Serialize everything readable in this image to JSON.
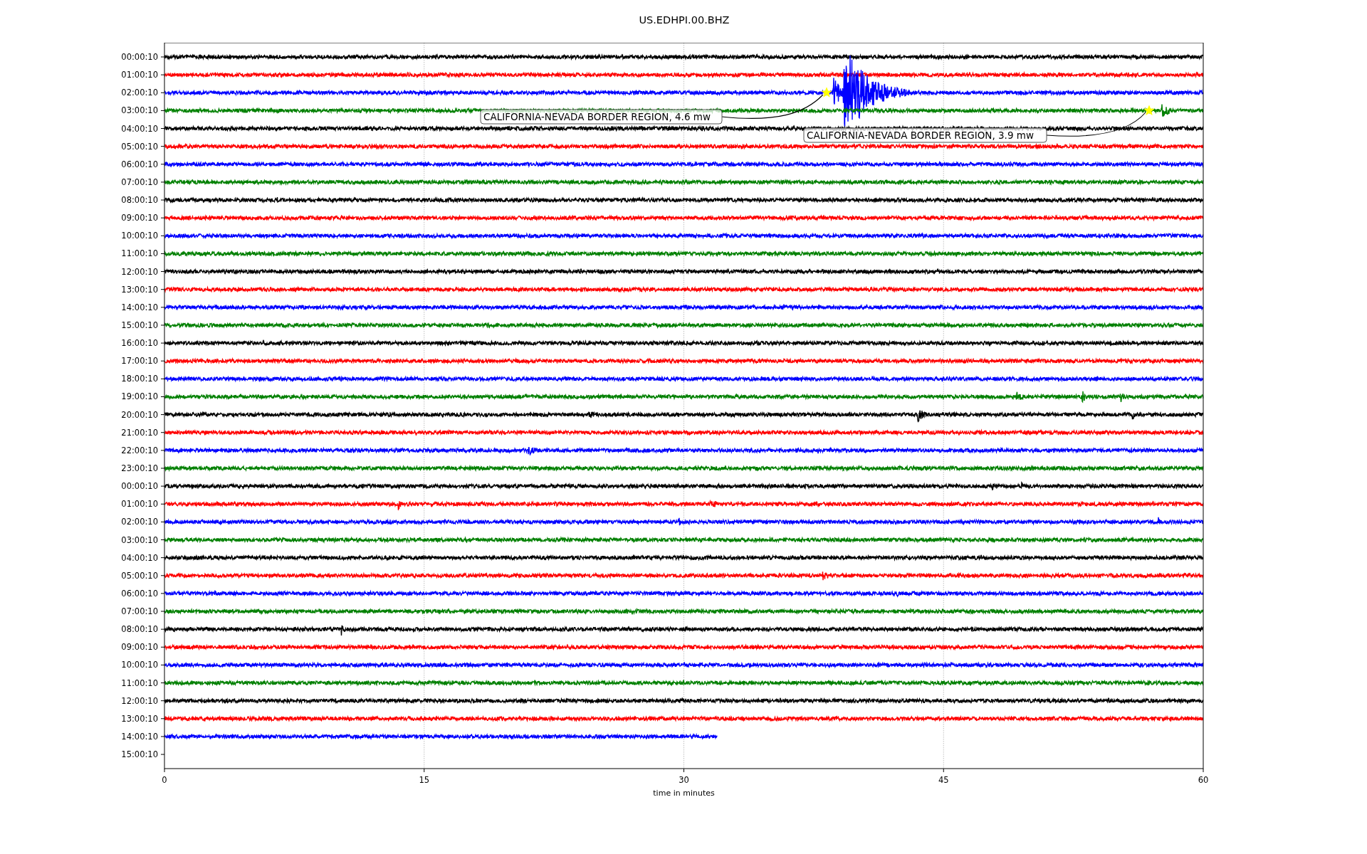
{
  "title": "US.EDHPI.00.BHZ",
  "rows": [
    {
      "label": "00:00:10",
      "kind": "full"
    },
    {
      "label": "01:00:10",
      "kind": "full"
    },
    {
      "label": "02:00:10",
      "kind": "full",
      "event": "CALIFORNIA-NEVADA BORDER REGION, 4.6 mw"
    },
    {
      "label": "03:00:10",
      "kind": "full",
      "event": "CALIFORNIA-NEVADA BORDER REGION, 3.9 mw"
    },
    {
      "label": "04:00:10",
      "kind": "full"
    },
    {
      "label": "05:00:10",
      "kind": "full"
    },
    {
      "label": "06:00:10",
      "kind": "full"
    },
    {
      "label": "07:00:10",
      "kind": "full"
    },
    {
      "label": "08:00:10",
      "kind": "full"
    },
    {
      "label": "09:00:10",
      "kind": "full"
    },
    {
      "label": "10:00:10",
      "kind": "full"
    },
    {
      "label": "11:00:10",
      "kind": "full"
    },
    {
      "label": "12:00:10",
      "kind": "full"
    },
    {
      "label": "13:00:10",
      "kind": "full"
    },
    {
      "label": "14:00:10",
      "kind": "full"
    },
    {
      "label": "15:00:10",
      "kind": "full"
    },
    {
      "label": "16:00:10",
      "kind": "full"
    },
    {
      "label": "17:00:10",
      "kind": "full"
    },
    {
      "label": "18:00:10",
      "kind": "full"
    },
    {
      "label": "19:00:10",
      "kind": "full"
    },
    {
      "label": "20:00:10",
      "kind": "full"
    },
    {
      "label": "21:00:10",
      "kind": "full"
    },
    {
      "label": "22:00:10",
      "kind": "full"
    },
    {
      "label": "23:00:10",
      "kind": "full"
    },
    {
      "label": "00:00:10",
      "kind": "full"
    },
    {
      "label": "01:00:10",
      "kind": "full"
    },
    {
      "label": "02:00:10",
      "kind": "full"
    },
    {
      "label": "03:00:10",
      "kind": "full"
    },
    {
      "label": "04:00:10",
      "kind": "full"
    },
    {
      "label": "05:00:10",
      "kind": "full"
    },
    {
      "label": "06:00:10",
      "kind": "full"
    },
    {
      "label": "07:00:10",
      "kind": "full"
    },
    {
      "label": "08:00:10",
      "kind": "full"
    },
    {
      "label": "09:00:10",
      "kind": "full"
    },
    {
      "label": "10:00:10",
      "kind": "full"
    },
    {
      "label": "11:00:10",
      "kind": "full"
    },
    {
      "label": "12:00:10",
      "kind": "full"
    },
    {
      "label": "13:00:10",
      "kind": "full"
    },
    {
      "label": "14:00:10",
      "kind": "partial"
    },
    {
      "label": "15:00:10",
      "kind": "empty"
    }
  ],
  "x_axis": {
    "ticks": [
      "0",
      "15",
      "30",
      "45",
      "60"
    ],
    "label": "time in minutes"
  }
}
